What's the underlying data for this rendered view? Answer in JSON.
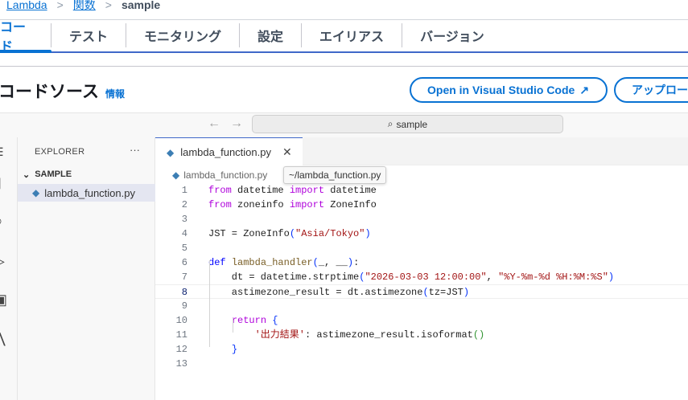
{
  "breadcrumb": {
    "items": [
      "Lambda",
      "関数"
    ],
    "current": "sample"
  },
  "tabs": [
    "コード",
    "テスト",
    "モニタリング",
    "設定",
    "エイリアス",
    "バージョン"
  ],
  "section": {
    "title": "コードソース",
    "info": "情報"
  },
  "buttons": {
    "open_vscode": "Open in Visual Studio Code",
    "upload": "アップロード元"
  },
  "ide": {
    "search": "sample",
    "explorer_title": "EXPLORER",
    "folder": "SAMPLE",
    "file": "lambda_function.py",
    "tab": "lambda_function.py",
    "breadcrumb_file": "lambda_function.py",
    "tooltip": "~/lambda_function.py",
    "current_line": 8,
    "lines": [
      [
        [
          "from",
          "kw"
        ],
        [
          " datetime ",
          "id"
        ],
        [
          "import",
          "kw"
        ],
        [
          " datetime",
          "id"
        ]
      ],
      [
        [
          "from",
          "kw"
        ],
        [
          " zoneinfo ",
          "id"
        ],
        [
          "import",
          "kw"
        ],
        [
          " ZoneInfo",
          "id"
        ]
      ],
      [],
      [
        [
          "JST = ZoneInfo",
          "id"
        ],
        [
          "(",
          "p1"
        ],
        [
          "\"Asia/Tokyo\"",
          "st"
        ],
        [
          ")",
          "p1"
        ]
      ],
      [],
      [
        [
          "def",
          "kd"
        ],
        [
          " ",
          "id"
        ],
        [
          "lambda_handler",
          "fn"
        ],
        [
          "(",
          "p1"
        ],
        [
          "_, __",
          "id"
        ],
        [
          ")",
          "p1"
        ],
        [
          ":",
          "id"
        ]
      ],
      [
        [
          "    dt = datetime.strptime",
          "id"
        ],
        [
          "(",
          "p1"
        ],
        [
          "\"2026-03-03 12:00:00\"",
          "st"
        ],
        [
          ", ",
          "id"
        ],
        [
          "\"%Y-%m-%d %H:%M:%S\"",
          "st"
        ],
        [
          ")",
          "p1"
        ]
      ],
      [
        [
          "    astimezone_result = dt.astimezone",
          "id"
        ],
        [
          "(",
          "p1"
        ],
        [
          "tz=JST",
          "id"
        ],
        [
          ")",
          "p1"
        ]
      ],
      [],
      [
        [
          "    ",
          "id"
        ],
        [
          "return",
          "kw"
        ],
        [
          " ",
          "id"
        ],
        [
          "{",
          "p1"
        ]
      ],
      [
        [
          "        ",
          "id"
        ],
        [
          "'出力結果'",
          "st"
        ],
        [
          ": astimezone_result.isoformat",
          "id"
        ],
        [
          "()",
          "p2"
        ]
      ],
      [
        [
          "    ",
          "id"
        ],
        [
          "}",
          "p1"
        ]
      ],
      []
    ]
  }
}
